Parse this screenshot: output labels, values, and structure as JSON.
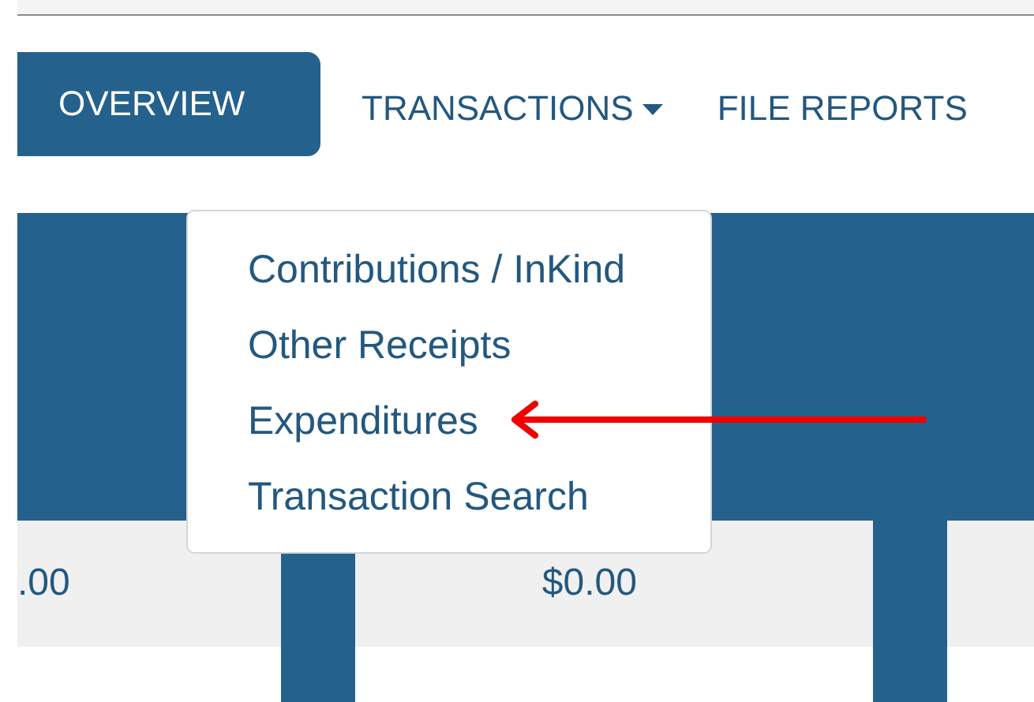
{
  "nav": {
    "tabs": [
      {
        "label": "OVERVIEW",
        "selected": true,
        "kind": "link"
      },
      {
        "label": "TRANSACTIONS",
        "selected": false,
        "kind": "dropdown"
      },
      {
        "label": "FILE REPORTS",
        "selected": false,
        "kind": "link"
      }
    ]
  },
  "menu": {
    "expanded": true,
    "items": [
      "Contributions / InKind",
      "Other Receipts",
      "Expenditures",
      "Transaction Search"
    ]
  },
  "summary_row": {
    "cells": [
      ".00",
      "$0.00"
    ]
  }
}
